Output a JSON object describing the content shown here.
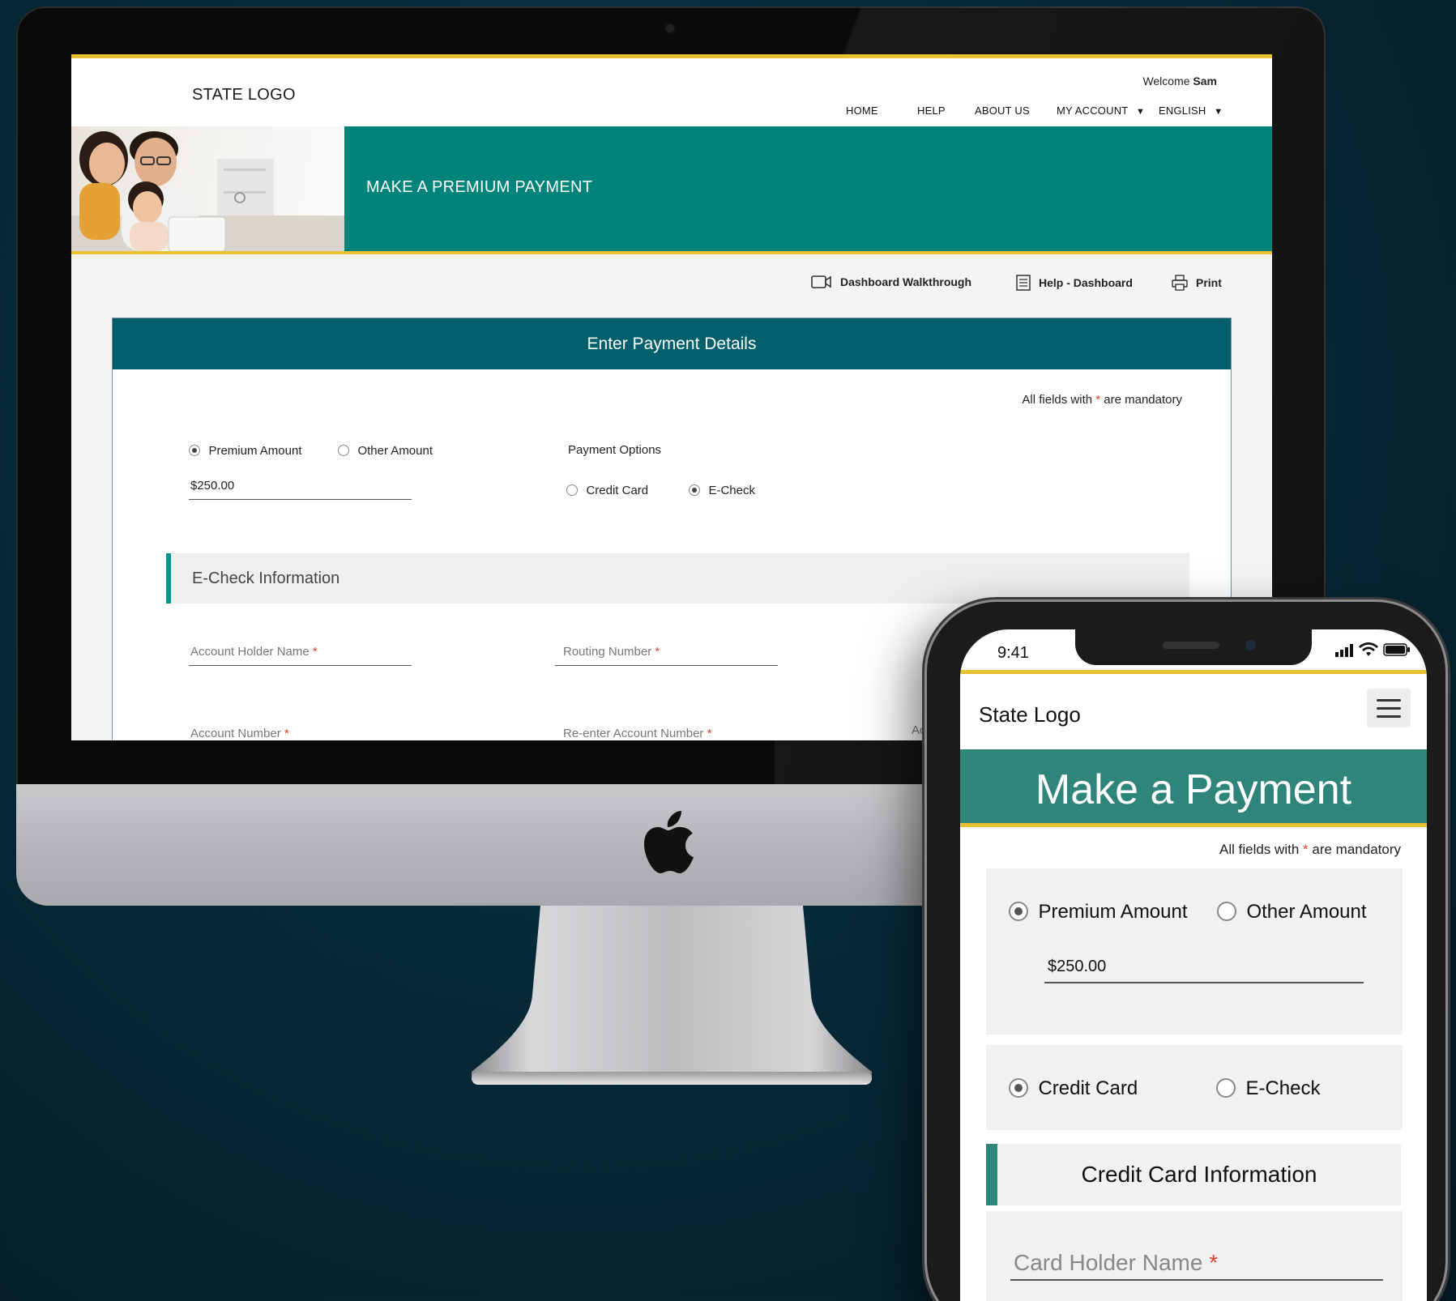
{
  "desktop": {
    "header": {
      "logo": "STATE LOGO",
      "welcome_prefix": "Welcome",
      "welcome_user": "Sam",
      "nav": [
        {
          "label": "HOME"
        },
        {
          "label": "HELP"
        },
        {
          "label": "ABOUT US"
        },
        {
          "label": "MY ACCOUNT"
        },
        {
          "label": "ENGLISH"
        }
      ]
    },
    "banner_title": "MAKE A PREMIUM PAYMENT",
    "toolbar": {
      "walkthrough": "Dashboard Walkthrough",
      "help": "Help - Dashboard",
      "print": "Print"
    },
    "form": {
      "title": "Enter Payment Details",
      "mandatory_prefix": "All fields with",
      "mandatory_star": "*",
      "mandatory_suffix": "are mandatory",
      "amount_options": [
        {
          "label": "Premium Amount",
          "selected": true
        },
        {
          "label": "Other Amount",
          "selected": false
        }
      ],
      "amount_value": "$250.00",
      "payment_options_label": "Payment Options",
      "payment_options": [
        {
          "label": "Credit Card",
          "selected": false
        },
        {
          "label": "E-Check",
          "selected": true
        }
      ],
      "section_title": "E-Check Information",
      "fields": {
        "account_holder": "Account Holder Name",
        "routing": "Routing Number",
        "account_number": "Account Number",
        "reenter_account": "Re-enter Account Number",
        "partial": "Ac"
      },
      "star": "*"
    }
  },
  "phone": {
    "time": "9:41",
    "logo": "State Logo",
    "banner_title": "Make a Payment",
    "mandatory_prefix": "All fields with",
    "mandatory_star": "*",
    "mandatory_suffix": "are mandatory",
    "amount_options": [
      {
        "label": "Premium Amount",
        "selected": true
      },
      {
        "label": "Other Amount",
        "selected": false
      }
    ],
    "amount_value": "$250.00",
    "payment_options": [
      {
        "label": "Credit Card",
        "selected": true
      },
      {
        "label": "E-Check",
        "selected": false
      }
    ],
    "section_title": "Credit Card Information",
    "card_holder_placeholder": "Card Holder Name",
    "star": "*"
  },
  "colors": {
    "teal": "#008378",
    "dark_teal": "#005f6b",
    "yellow": "#e9c233",
    "required": "#d6452b"
  }
}
